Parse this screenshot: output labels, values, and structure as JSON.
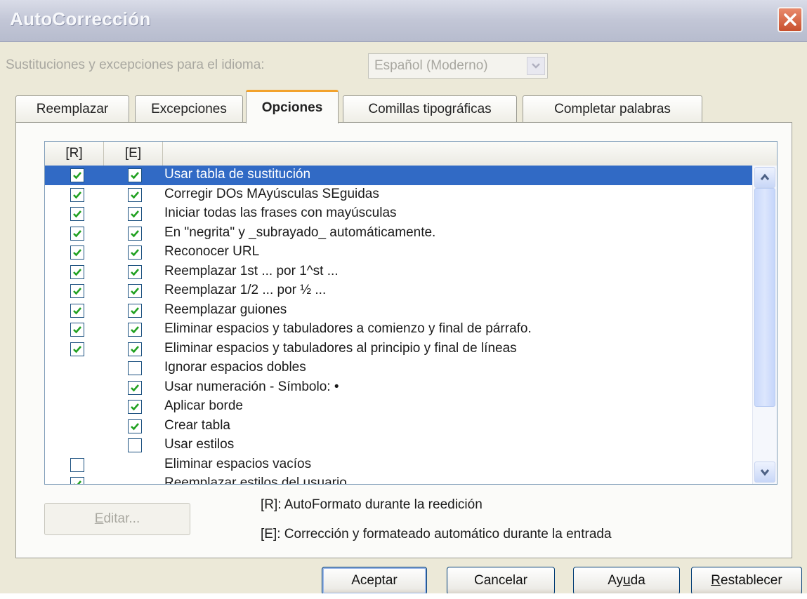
{
  "window": {
    "title": "AutoCorrección"
  },
  "language": {
    "label": "Sustituciones y excepciones para el idioma:",
    "value": "Español (Moderno)"
  },
  "tabs": [
    {
      "label": "Reemplazar",
      "active": false
    },
    {
      "label": "Excepciones",
      "active": false
    },
    {
      "label": "Opciones",
      "active": true
    },
    {
      "label": "Comillas tipográficas",
      "active": false
    },
    {
      "label": "Completar palabras",
      "active": false
    }
  ],
  "list": {
    "headers": {
      "r": "[R]",
      "e": "[E]",
      "label": ""
    },
    "rows": [
      {
        "label": "Usar tabla de sustitución",
        "r": true,
        "e": true,
        "selected": true
      },
      {
        "label": "Corregir DOs MAyúsculas SEguidas",
        "r": true,
        "e": true
      },
      {
        "label": "Iniciar todas las frases con mayúsculas",
        "r": true,
        "e": true
      },
      {
        "label": "En \"negrita\" y _subrayado_ automáticamente.",
        "r": true,
        "e": true
      },
      {
        "label": "Reconocer URL",
        "r": true,
        "e": true
      },
      {
        "label": "Reemplazar 1st ... por 1^st ...",
        "r": true,
        "e": true
      },
      {
        "label": "Reemplazar 1/2 ... por ½ ...",
        "r": true,
        "e": true
      },
      {
        "label": "Reemplazar guiones",
        "r": true,
        "e": true
      },
      {
        "label": "Eliminar espacios y tabuladores a comienzo y final de párrafo.",
        "r": true,
        "e": true
      },
      {
        "label": "Eliminar espacios y tabuladores al principio y final de líneas",
        "r": true,
        "e": true
      },
      {
        "label": "Ignorar espacios dobles",
        "r": null,
        "e": false
      },
      {
        "label": "Usar numeración - Símbolo: •",
        "r": null,
        "e": true
      },
      {
        "label": "Aplicar borde",
        "r": null,
        "e": true
      },
      {
        "label": "Crear tabla",
        "r": null,
        "e": true
      },
      {
        "label": "Usar estilos",
        "r": null,
        "e": false
      },
      {
        "label": "Eliminar espacios vacíos",
        "r": false,
        "e": null
      },
      {
        "label": "Reemplazar estilos del usuario",
        "r": true,
        "e": null
      }
    ]
  },
  "edit_button": {
    "label_pre": "",
    "label_u": "E",
    "label_post": "ditar..."
  },
  "legend": {
    "r": "[R]: AutoFormato durante la reedición",
    "e": "[E]: Corrección y formateado automático durante la entrada"
  },
  "buttons": {
    "ok": "Aceptar",
    "cancel": "Cancelar",
    "help_pre": "Ay",
    "help_u": "u",
    "help_post": "da",
    "reset_pre": "",
    "reset_u": "R",
    "reset_post": "establecer"
  },
  "colors": {
    "selection": "#316ac5",
    "check": "#21a121",
    "active_tab_accent": "#f2a22c"
  }
}
